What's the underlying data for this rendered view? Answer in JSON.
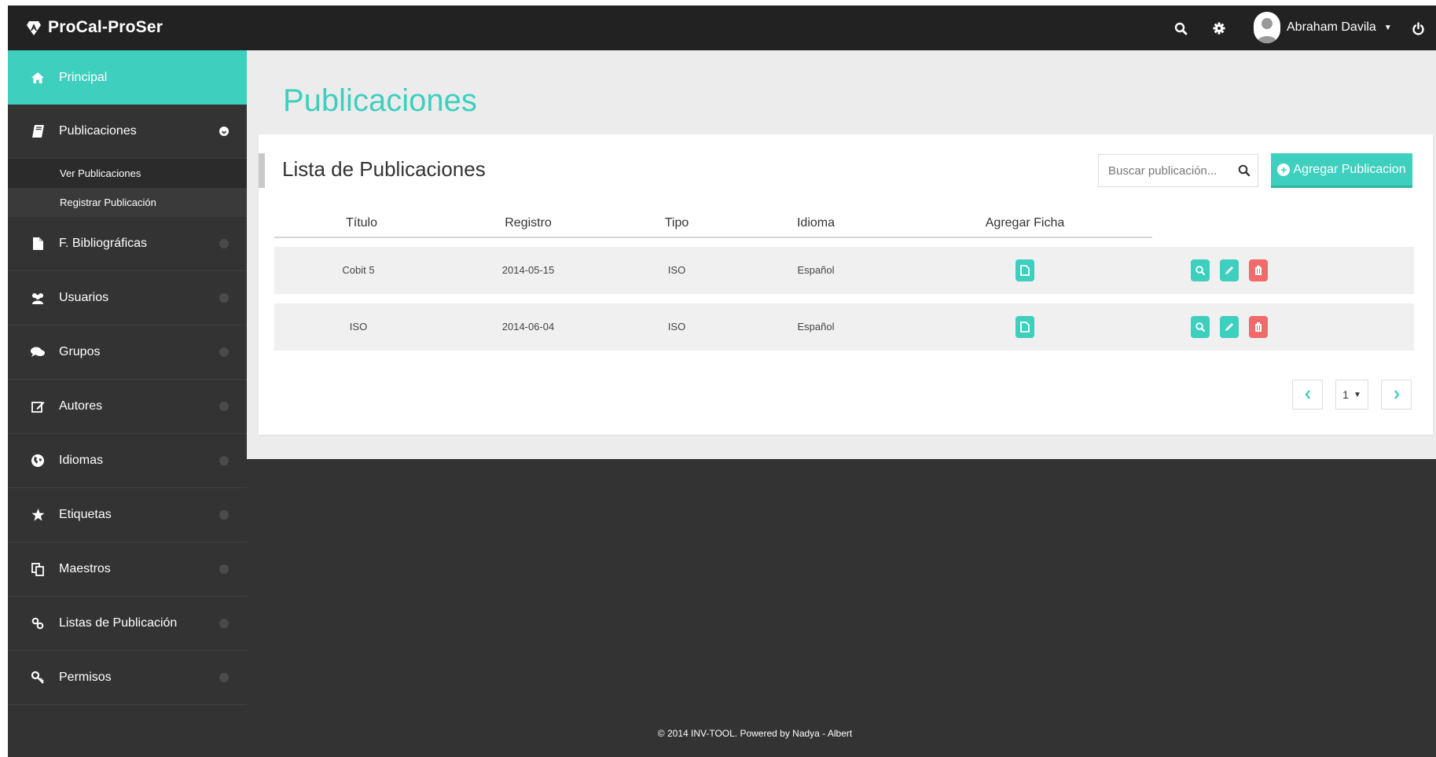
{
  "app": {
    "brand": "ProCal-ProSer"
  },
  "topbar": {
    "user_name": "Abraham Davila"
  },
  "colors": {
    "accent": "#3ecfbf",
    "danger": "#f06b6b",
    "dark": "#333333",
    "topbar": "#222222"
  },
  "sidebar": {
    "items": [
      {
        "label": "Principal",
        "icon": "home-icon",
        "active": true
      },
      {
        "label": "Publicaciones",
        "icon": "book-icon",
        "open": true,
        "subitems": [
          {
            "label": "Ver Publicaciones"
          },
          {
            "label": "Registrar Publicación"
          }
        ]
      },
      {
        "label": "F. Bibliográficas",
        "icon": "file-icon"
      },
      {
        "label": "Usuarios",
        "icon": "users-icon"
      },
      {
        "label": "Grupos",
        "icon": "chat-icon"
      },
      {
        "label": "Autores",
        "icon": "edit-icon"
      },
      {
        "label": "Idiomas",
        "icon": "globe-icon"
      },
      {
        "label": "Etiquetas",
        "icon": "star-icon"
      },
      {
        "label": "Maestros",
        "icon": "copy-icon"
      },
      {
        "label": "Listas de Publicación",
        "icon": "link-icon"
      },
      {
        "label": "Permisos",
        "icon": "key-icon"
      }
    ]
  },
  "main": {
    "page_title": "Publicaciones",
    "panel_title": "Lista de Publicaciones",
    "search": {
      "placeholder": "Buscar publicación..."
    },
    "add_button": "Agregar Publicacion",
    "table": {
      "headers": [
        "Título",
        "Registro",
        "Tipo",
        "Idioma",
        "Agregar Ficha"
      ],
      "rows": [
        {
          "titulo": "Cobit 5",
          "registro": "2014-05-15",
          "tipo": "ISO",
          "idioma": "Español"
        },
        {
          "titulo": "ISO",
          "registro": "2014-06-04",
          "tipo": "ISO",
          "idioma": "Español"
        }
      ]
    },
    "pagination": {
      "current_page": "1"
    }
  },
  "footer": {
    "text": "© 2014 INV-TOOL. Powered by Nadya - Albert"
  }
}
